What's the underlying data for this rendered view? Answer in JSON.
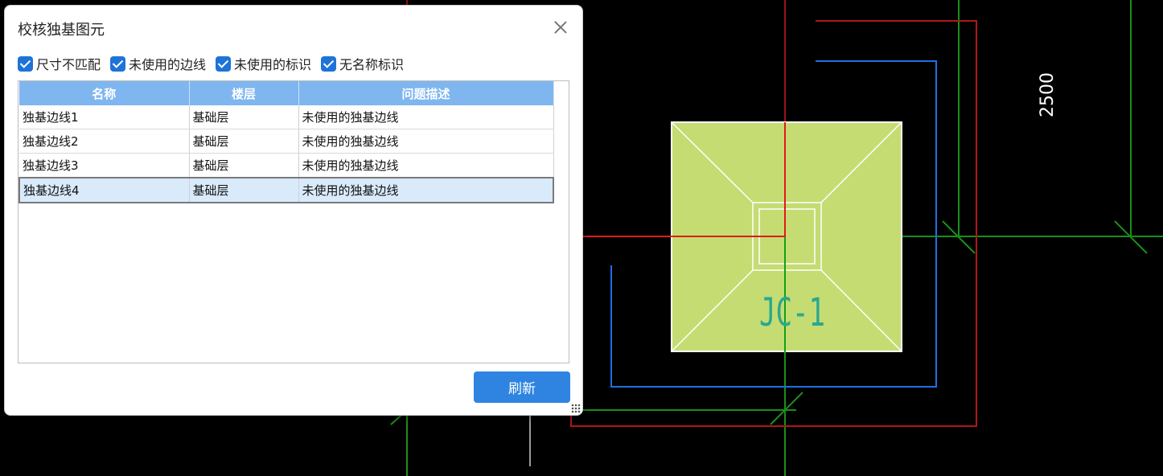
{
  "dialog": {
    "title": "校核独基图元",
    "filters": [
      {
        "label": "尺寸不匹配",
        "checked": true
      },
      {
        "label": "未使用的边线",
        "checked": true
      },
      {
        "label": "未使用的标识",
        "checked": true
      },
      {
        "label": "无名称标识",
        "checked": true
      }
    ],
    "table": {
      "columns": [
        "名称",
        "楼层",
        "问题描述"
      ],
      "rows": [
        {
          "name": "独基边线1",
          "floor": "基础层",
          "desc": "未使用的独基边线"
        },
        {
          "name": "独基边线2",
          "floor": "基础层",
          "desc": "未使用的独基边线"
        },
        {
          "name": "独基边线3",
          "floor": "基础层",
          "desc": "未使用的独基边线"
        },
        {
          "name": "独基边线4",
          "floor": "基础层",
          "desc": "未使用的独基边线",
          "selected": true
        }
      ]
    },
    "refresh_label": "刷新"
  },
  "cad": {
    "dimension_text": "2500",
    "foundation_label": "JC-1",
    "colors": {
      "background": "#000000",
      "foundation_fill": "#c5dc72",
      "red_line": "#c41616",
      "green_line": "#14a014",
      "blue_line": "#1f6fe0"
    }
  }
}
